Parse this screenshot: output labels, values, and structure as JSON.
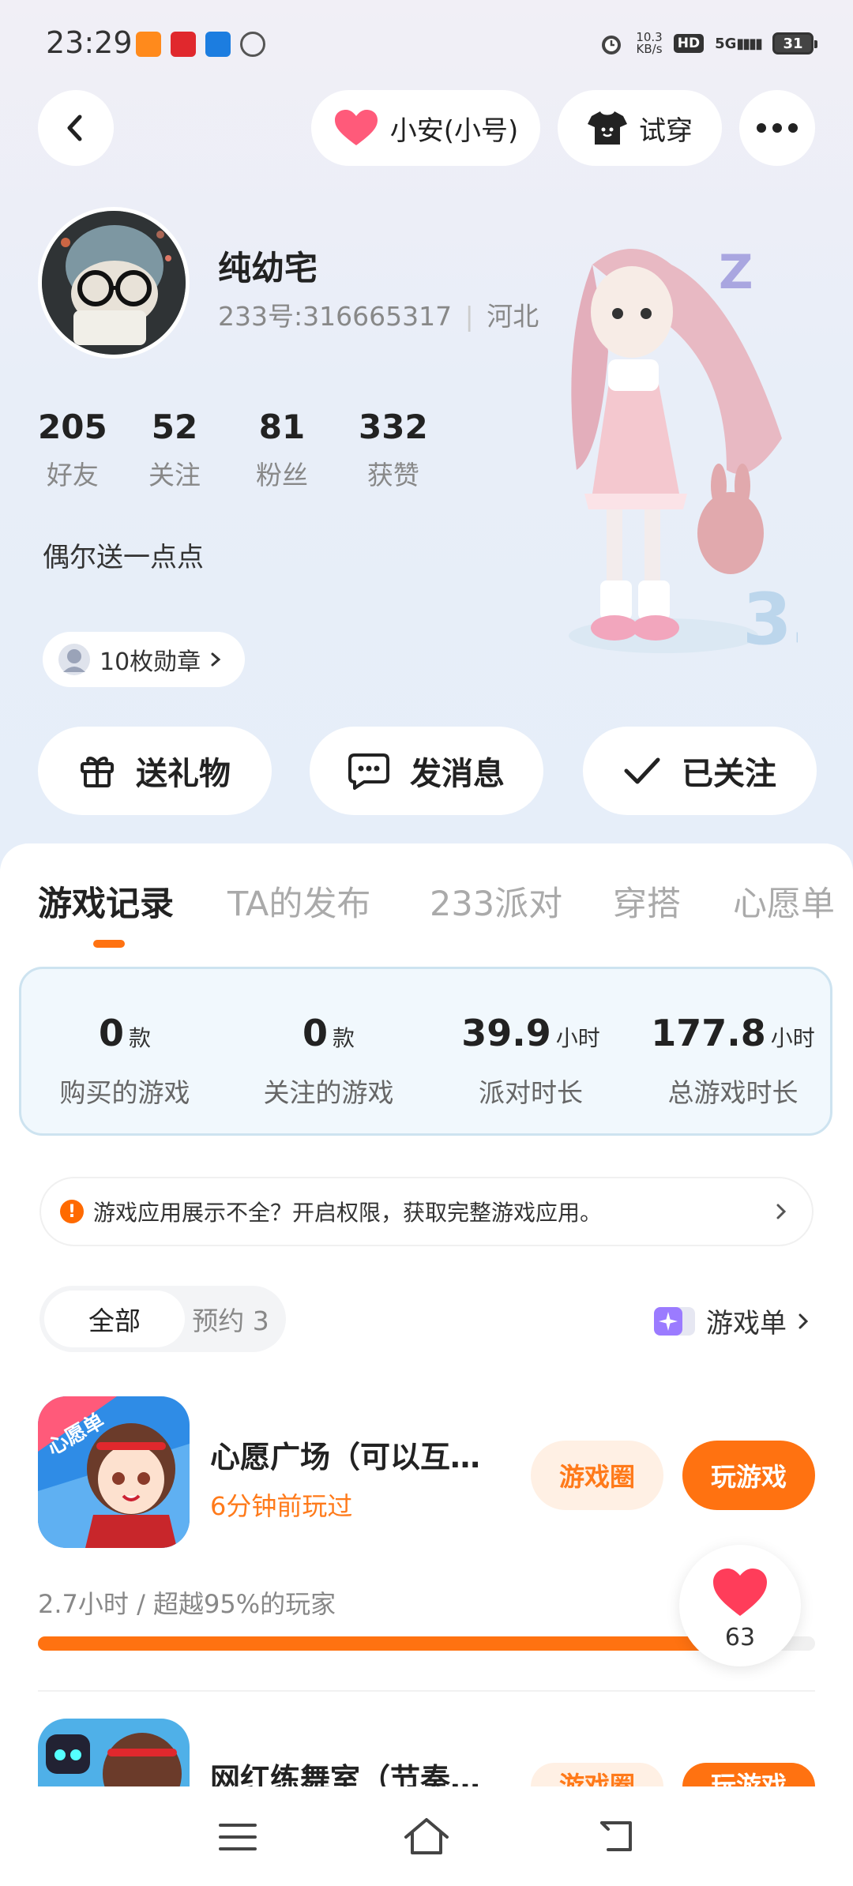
{
  "status": {
    "time": "23:29",
    "net_speed_value": "10.3",
    "net_speed_unit": "KB/s",
    "hd": "HD",
    "signal": "5G",
    "battery": "31"
  },
  "header": {
    "account_switch_label": "小安(小号)",
    "try_on_label": "试穿"
  },
  "profile": {
    "nickname": "纯幼宅",
    "id_text": "233号:316665317",
    "region": "河北",
    "stats": [
      {
        "value": "205",
        "label": "好友"
      },
      {
        "value": "52",
        "label": "关注"
      },
      {
        "value": "81",
        "label": "粉丝"
      },
      {
        "value": "332",
        "label": "获赞"
      }
    ],
    "bio": "偶尔送一点点",
    "medal_label": "10枚勋章"
  },
  "actions": {
    "gift": "送礼物",
    "message": "发消息",
    "followed": "已关注"
  },
  "tabs": [
    "游戏记录",
    "TA的发布",
    "233派对",
    "穿搭",
    "心愿单"
  ],
  "summary": [
    {
      "value": "0",
      "unit": "款",
      "label": "购买的游戏"
    },
    {
      "value": "0",
      "unit": "款",
      "label": "关注的游戏"
    },
    {
      "value": "39.9",
      "unit": "小时",
      "label": "派对时长"
    },
    {
      "value": "177.8",
      "unit": "小时",
      "label": "总游戏时长"
    }
  ],
  "notice": "游戏应用展示不全？开启权限，获取完整游戏应用。",
  "filter": {
    "all": "全部",
    "reserve": "预约 3",
    "game_list": "游戏单"
  },
  "games": [
    {
      "icon_badge": "心愿单",
      "name": "心愿广场（可以互…",
      "sub": "6分钟前玩过",
      "circle": "游戏圈",
      "play": "玩游戏",
      "playtime": "2.7小时 / 超越95%的玩家",
      "progress": 0.95
    },
    {
      "name": "网红练舞室（节奏…",
      "circle": "游戏圈",
      "play": "玩游戏"
    }
  ],
  "like": {
    "count": "63"
  },
  "colors": {
    "accent": "#ff7211",
    "heart": "#ff3d5a"
  }
}
